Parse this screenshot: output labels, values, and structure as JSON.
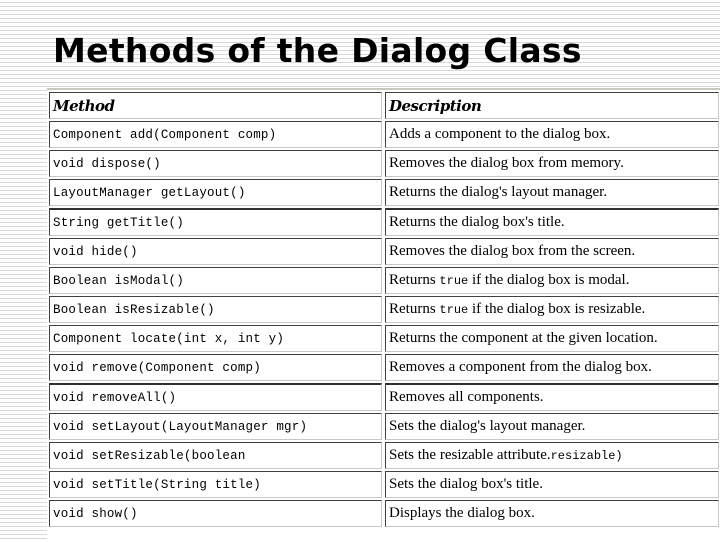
{
  "slide": {
    "title": "Methods of the Dialog Class"
  },
  "table": {
    "headers": {
      "method": "Method",
      "description": "Description"
    },
    "rows": [
      {
        "method": "Component add(Component comp)",
        "description": "Adds a component to the dialog box.",
        "desc_pre": "",
        "desc_code": "",
        "desc_post": ""
      },
      {
        "method": "void dispose()",
        "description": "Removes the dialog box from memory.",
        "desc_pre": "",
        "desc_code": "",
        "desc_post": ""
      },
      {
        "method": "LayoutManager getLayout()",
        "description": "Returns the dialog's layout manager.",
        "desc_pre": "",
        "desc_code": "",
        "desc_post": ""
      },
      {
        "method": "String getTitle()",
        "description": "Returns the dialog box's title.",
        "desc_pre": "",
        "desc_code": "",
        "desc_post": ""
      },
      {
        "method": "void hide()",
        "description": "Removes the dialog box from the screen.",
        "desc_pre": "",
        "desc_code": "",
        "desc_post": ""
      },
      {
        "method": "Boolean isModal()",
        "description": "",
        "desc_pre": "Returns ",
        "desc_code": "true",
        "desc_post": " if the dialog box is modal."
      },
      {
        "method": "Boolean isResizable()",
        "description": "",
        "desc_pre": "Returns ",
        "desc_code": "true",
        "desc_post": " if the dialog box is resizable."
      },
      {
        "method": "Component locate(int x, int y)",
        "description": "Returns the component at the given location.",
        "desc_pre": "",
        "desc_code": "",
        "desc_post": ""
      },
      {
        "method": "void remove(Component comp)",
        "description": "Removes a component from the dialog box.",
        "desc_pre": "",
        "desc_code": "",
        "desc_post": ""
      },
      {
        "method": "void removeAll()",
        "description": "Removes all components.",
        "desc_pre": "",
        "desc_code": "",
        "desc_post": ""
      },
      {
        "method": "void setLayout(LayoutManager mgr)",
        "description": "Sets the dialog's layout manager.",
        "desc_pre": "",
        "desc_code": "",
        "desc_post": ""
      },
      {
        "method": "void setResizable(boolean",
        "description": "",
        "desc_pre": "Sets the resizable attribute.",
        "desc_code": "resizable)",
        "desc_post": ""
      },
      {
        "method": "void setTitle(String title)",
        "description": "Sets the dialog box's title.",
        "desc_pre": "",
        "desc_code": "",
        "desc_post": ""
      },
      {
        "method": "void show()",
        "description": "Displays the dialog box.",
        "desc_pre": "",
        "desc_code": "",
        "desc_post": ""
      }
    ]
  }
}
